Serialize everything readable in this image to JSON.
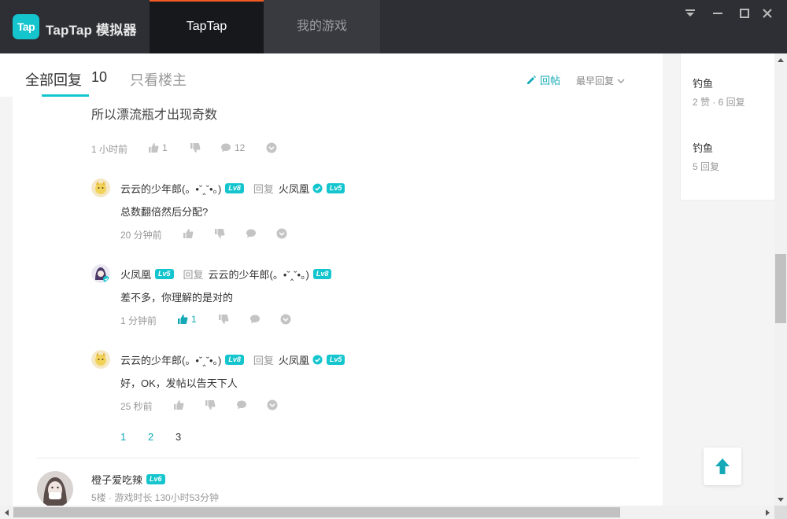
{
  "titlebar": {
    "logo_badge": "Tap",
    "logo_text": "TapTap 模拟器",
    "tabs": [
      {
        "label": "TapTap",
        "active": true
      },
      {
        "label": "我的游戏",
        "active": false
      }
    ],
    "window_buttons": [
      "dropdown-icon",
      "minimize-icon",
      "maximize-icon",
      "close-icon"
    ]
  },
  "header": {
    "all_replies_label": "全部回复",
    "reply_count": "10",
    "owner_only_label": "只看楼主",
    "reply_button_label": "回帖",
    "sort_label": "最早回复"
  },
  "main_comment": {
    "text": "所以漂流瓶才出现奇数",
    "time": "1 小时前",
    "likes": "1",
    "comments": "12"
  },
  "sub_replies": [
    {
      "author": "云云的少年郎(。•ˇ‸ˇ•。)",
      "author_level": "Lv8",
      "reply_word": "回复",
      "target": "火凤凰",
      "target_level": "Lv5",
      "target_verified": true,
      "text": "总数翻倍然后分配?",
      "time": "20 分钟前",
      "likes": ""
    },
    {
      "author": "火凤凰",
      "author_level": "Lv5",
      "reply_word": "回复",
      "target": "云云的少年郎(。•ˇ‸ˇ•。)",
      "target_level": "Lv8",
      "target_verified": false,
      "text": "差不多，你理解的是对的",
      "time": "1 分钟前",
      "likes": "1"
    },
    {
      "author": "云云的少年郎(。•ˇ‸ˇ•。)",
      "author_level": "Lv8",
      "reply_word": "回复",
      "target": "火凤凰",
      "target_level": "Lv5",
      "target_verified": true,
      "text": "好，OK，发帖以告天下人",
      "time": "25 秒前",
      "likes": ""
    }
  ],
  "pagination": {
    "pages": [
      "1",
      "2",
      "3"
    ],
    "current": "3"
  },
  "next_floor": {
    "author": "橙子爱吃辣",
    "level": "Lv6",
    "meta": "5楼 · 游戏时长 130小时53分钟"
  },
  "sidebar": {
    "items": [
      {
        "title": "钓鱼",
        "sub": "2 赞 · 6 回复"
      },
      {
        "title": "钓鱼",
        "sub": "5 回复"
      }
    ]
  },
  "colors": {
    "accent": "#15c5ce",
    "accent_text": "#15a9b8",
    "titlebar_bg": "#2e2f34",
    "active_tab_border": "#f05a23"
  }
}
